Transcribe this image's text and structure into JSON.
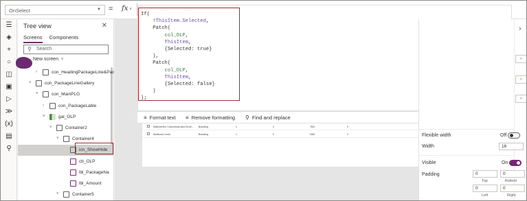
{
  "formula_bar": {
    "property": "OnSelect",
    "equals": "=",
    "fx": "fx"
  },
  "code_lines": [
    "If(",
    "    !ThisItem.Selected,",
    "    Patch(",
    "        col_OLP,",
    "        ThisItem,",
    "        {Selected: true}",
    "    ),",
    "    Patch(",
    "        col_OLP,",
    "        ThisItem,",
    "        {Selected: false}",
    "    )",
    ");"
  ],
  "formula_toolbar": {
    "format": "Format text",
    "remove": "Remove formatting",
    "find": "Find and replace"
  },
  "tree": {
    "title": "Tree view",
    "tabs": [
      "Screens",
      "Components"
    ],
    "search_placeholder": "Search",
    "new_screen": "New screen",
    "items": [
      {
        "label": "con_HeadingPackageLine&Packa",
        "indent": 2,
        "icon": "container",
        "chev": ">"
      },
      {
        "label": "con_PackageLineGallery",
        "indent": 1,
        "icon": "container",
        "chev": "v"
      },
      {
        "label": "con_MainPLG",
        "indent": 2,
        "icon": "container",
        "chev": "v"
      },
      {
        "label": "con_PackageLable",
        "indent": 3,
        "icon": "container",
        "chev": ">"
      },
      {
        "label": "gal_OLP",
        "indent": 3,
        "icon": "gallery",
        "chev": "v"
      },
      {
        "label": "Container2",
        "indent": 4,
        "icon": "container",
        "chev": "v"
      },
      {
        "label": "Container4",
        "indent": 5,
        "icon": "container",
        "chev": "v"
      },
      {
        "label": "icn_ShowHide",
        "indent": 6,
        "icon": "icon",
        "chev": ""
      },
      {
        "label": "cb_OLP",
        "indent": 6,
        "icon": "check",
        "chev": ""
      },
      {
        "label": "lbl_PackageNa",
        "indent": 6,
        "icon": "label",
        "chev": ""
      },
      {
        "label": "lbl_Amount",
        "indent": 6,
        "icon": "label",
        "chev": ""
      },
      {
        "label": "Container5",
        "indent": 5,
        "icon": "container",
        "chev": "v"
      }
    ]
  },
  "canvas_rows": [
    {
      "c1": "Stationeries: Cartonhead plus Envel...",
      "c2": "Branding",
      "c3": "1",
      "c4": "0",
      "c5": "TBD",
      "c6": "0"
    },
    {
      "c1": "Notebook Cover",
      "c2": "Branding",
      "c3": "1",
      "c4": "0",
      "c5": "DBD",
      "c6": "0"
    }
  ],
  "props": {
    "flexible_width_label": "Flexible width",
    "flexible_width_value": "Off",
    "width_label": "Width",
    "width_value": "16",
    "visible_label": "Visible",
    "visible_value": "On",
    "padding_label": "Padding",
    "padding_top": "0",
    "padding_bottom": "0",
    "padding_left": "0",
    "padding_right": "0",
    "top_caption": "Top",
    "bottom_caption": "Bottom",
    "left_caption": "Left",
    "right_caption": "Right"
  },
  "colors": {
    "accent": "#742774",
    "highlight_border": "#a4262c"
  }
}
